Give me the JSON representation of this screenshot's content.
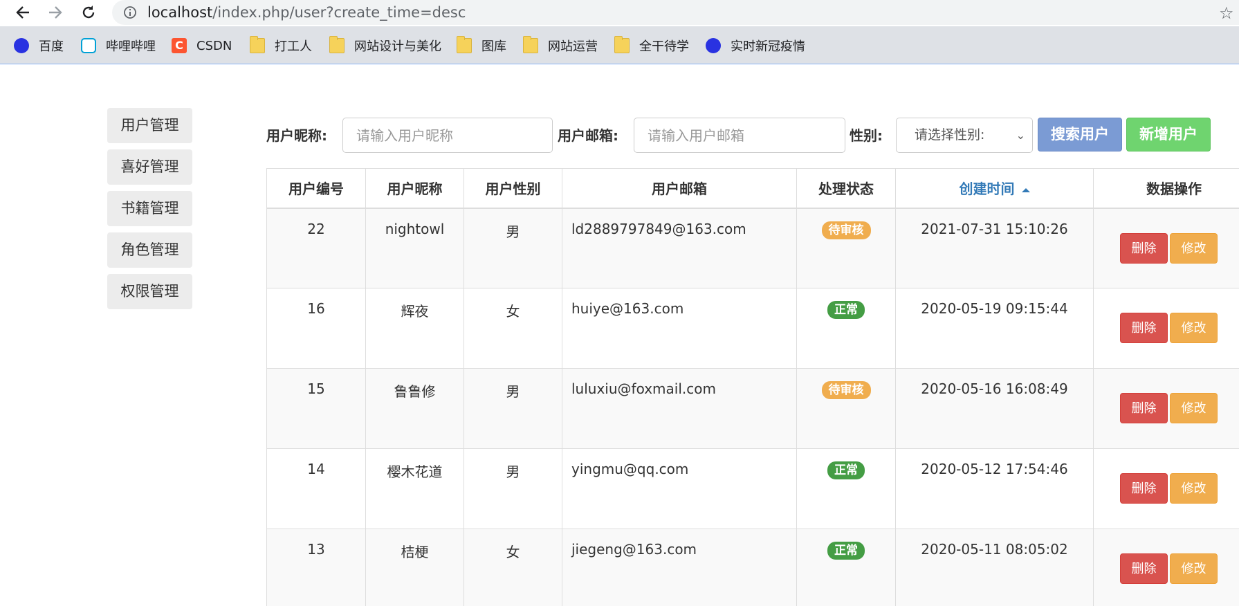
{
  "browser": {
    "url_host": "localhost",
    "url_path": "/index.php/user?create_time=desc",
    "bookmarks": [
      {
        "label": "百度",
        "icon": "baidu-icon"
      },
      {
        "label": "哔哩哔哩",
        "icon": "bilibili-icon"
      },
      {
        "label": "CSDN",
        "icon": "csdn-icon"
      },
      {
        "label": "打工人",
        "icon": "folder-icon"
      },
      {
        "label": "网站设计与美化",
        "icon": "folder-icon"
      },
      {
        "label": "图库",
        "icon": "folder-icon"
      },
      {
        "label": "网站运营",
        "icon": "folder-icon"
      },
      {
        "label": "全干待学",
        "icon": "folder-icon"
      },
      {
        "label": "实时新冠疫情",
        "icon": "baidu-icon"
      }
    ]
  },
  "sidebar": {
    "items": [
      {
        "label": "用户管理"
      },
      {
        "label": "喜好管理"
      },
      {
        "label": "书籍管理"
      },
      {
        "label": "角色管理"
      },
      {
        "label": "权限管理"
      }
    ]
  },
  "search": {
    "nickname_label": "用户昵称:",
    "nickname_placeholder": "请输入用户昵称",
    "email_label": "用户邮箱:",
    "email_placeholder": "请输入用户邮箱",
    "gender_label": "性别:",
    "gender_selected": "请选择性别:",
    "search_button": "搜索用户",
    "add_button": "新增用户"
  },
  "table": {
    "headers": [
      "用户编号",
      "用户昵称",
      "用户性别",
      "用户邮箱",
      "处理状态",
      "创建时间",
      "数据操作"
    ],
    "delete_label": "删除",
    "edit_label": "修改",
    "rows": [
      {
        "id": "22",
        "nickname": "nightowl",
        "gender": "男",
        "email": "ld2889797849@163.com",
        "status": "待审核",
        "created": "2021-07-31 15:10:26"
      },
      {
        "id": "16",
        "nickname": "辉夜",
        "gender": "女",
        "email": "huiye@163.com",
        "status": "正常",
        "created": "2020-05-19 09:15:44"
      },
      {
        "id": "15",
        "nickname": "鲁鲁修",
        "gender": "男",
        "email": "luluxiu@foxmail.com",
        "status": "待审核",
        "created": "2020-05-16 16:08:49"
      },
      {
        "id": "14",
        "nickname": "樱木花道",
        "gender": "男",
        "email": "yingmu@qq.com",
        "status": "正常",
        "created": "2020-05-12 17:54:46"
      },
      {
        "id": "13",
        "nickname": "桔梗",
        "gender": "女",
        "email": "jiegeng@163.com",
        "status": "正常",
        "created": "2020-05-11 08:05:02"
      }
    ]
  },
  "colors": {
    "status_pending": "#f0ad4e",
    "status_normal": "#449d44",
    "delete": "#d9534f",
    "edit": "#f0ad4e",
    "search_button": "#7b9bd4",
    "add_button": "#6fd46f",
    "sorted_header": "#337ab7"
  }
}
